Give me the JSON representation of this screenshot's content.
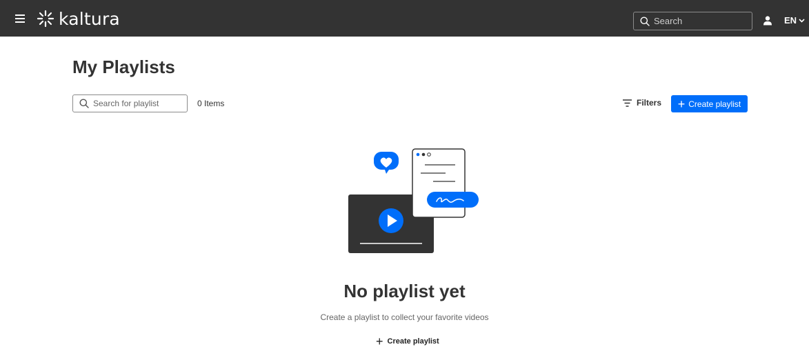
{
  "header": {
    "logo_text": "kaltura",
    "search_placeholder": "Search",
    "language": "EN",
    "icons": {
      "menu": "hamburger-icon",
      "logo": "kaltura-logo-icon",
      "search": "search-icon",
      "user": "user-icon",
      "dropdown": "chevron-down-icon"
    }
  },
  "page": {
    "title": "My Playlists",
    "search_placeholder": "Search for playlist",
    "items_count": "0 Items",
    "filters_label": "Filters",
    "create_label": "Create playlist"
  },
  "empty_state": {
    "title": "No playlist yet",
    "subtitle": "Create a playlist to collect your favorite videos",
    "create_label": "Create playlist"
  },
  "colors": {
    "topbar": "#333333",
    "accent": "#006efa",
    "text": "#333333",
    "muted": "#666666"
  }
}
